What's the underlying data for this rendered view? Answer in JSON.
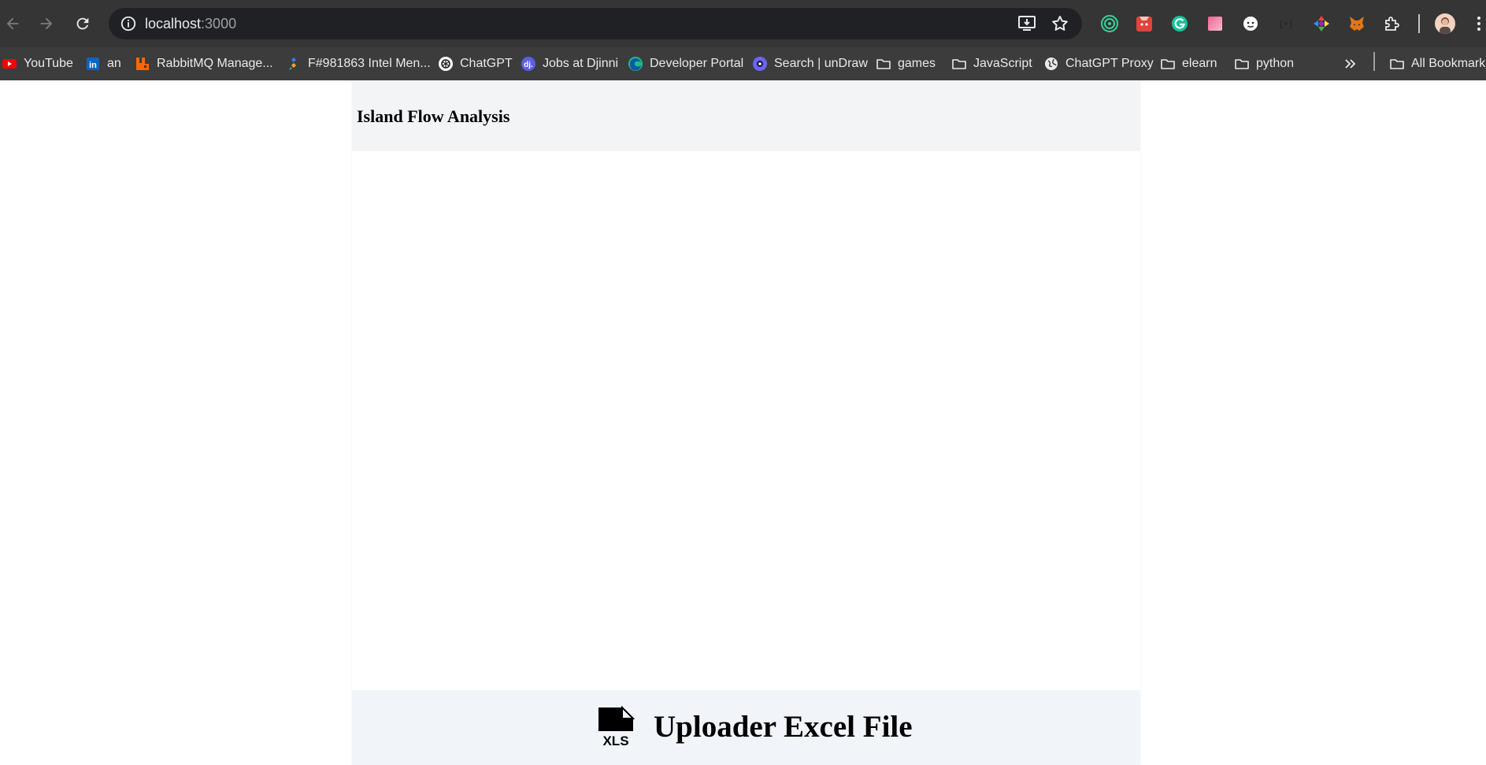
{
  "browser": {
    "url_host": "localhost",
    "url_port": ":3000",
    "extensions": [
      "target-extension-icon",
      "red-cat-extension-icon",
      "grammarly-icon",
      "pink-square-extension-icon",
      "face-extension-icon",
      "json-braces-extension-icon",
      "color-wheel-extension-icon",
      "metamask-fox-icon",
      "puzzle-piece-icon"
    ]
  },
  "bookmarks": [
    {
      "label": "YouTube",
      "icon": "youtube-icon"
    },
    {
      "label": "an",
      "icon": "linkedin-icon"
    },
    {
      "label": "RabbitMQ Manage...",
      "icon": "rabbitmq-icon"
    },
    {
      "label": "F#981863 Intel Men...",
      "icon": "jira-icon"
    },
    {
      "label": "ChatGPT",
      "icon": "openai-icon"
    },
    {
      "label": "Jobs at Djinni",
      "icon": "djinni-icon"
    },
    {
      "label": "Developer Portal",
      "icon": "edge-icon"
    },
    {
      "label": "Search | unDraw",
      "icon": "undraw-icon"
    },
    {
      "label": "games",
      "icon": "folder-icon"
    },
    {
      "label": "JavaScript",
      "icon": "folder-icon"
    },
    {
      "label": "ChatGPT Proxy",
      "icon": "globe-icon"
    },
    {
      "label": "elearn",
      "icon": "folder-icon"
    },
    {
      "label": "python",
      "icon": "folder-icon"
    }
  ],
  "all_bookmarks_label": "All Bookmarks",
  "app": {
    "title": "Island Flow Analysis",
    "uploader_label": "Uploader Excel File",
    "uploader_icon_text": "XLS"
  },
  "colors": {
    "chrome_dark": "#353535",
    "bookmarks_bar": "#3c3c3c",
    "header_bg": "#f3f4f6",
    "uploader_bg": "#f1f4f8"
  }
}
